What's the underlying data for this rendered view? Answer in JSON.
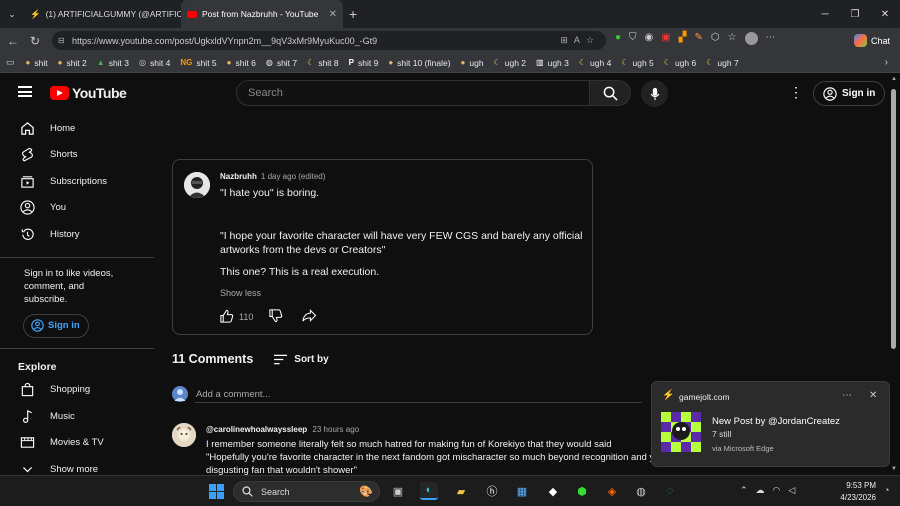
{
  "browser": {
    "tabs": [
      {
        "label": "(1) ARTIFICIALGUMMY (@ARTIFIC",
        "active": false
      },
      {
        "label": "Post from Nazbruhh - YouTube",
        "active": true
      }
    ],
    "url": "https://www.youtube.com/post/UgkxldVYnpn2m__9qV3xMr9MyuKuc00_-Gt9",
    "chat_label": "Chat",
    "bookmarks": [
      "shit",
      "shit 2",
      "shit 3",
      "shit 4",
      "shit 5",
      "shit 6",
      "shit 7",
      "shit 8",
      "shit 9",
      "shit 10 (finale)",
      "ugh",
      "ugh 2",
      "ugh 3",
      "ugh 4",
      "ugh 5",
      "ugh 6",
      "ugh 7"
    ]
  },
  "header": {
    "logo": "YouTube",
    "search_placeholder": "Search",
    "signin": "Sign in"
  },
  "sidebar": {
    "items": [
      "Home",
      "Shorts",
      "Subscriptions",
      "You",
      "History"
    ],
    "signin_note": "Sign in to like videos, comment, and subscribe.",
    "signin_button": "Sign in",
    "explore_title": "Explore",
    "explore_items": [
      "Shopping",
      "Music",
      "Movies & TV"
    ],
    "show_more": "Show more"
  },
  "post": {
    "author": "Nazbruhh",
    "time": "1 day ago (edited)",
    "lines": [
      "\"I hate you\" is boring.",
      "\"I hope your favorite character will have very FEW CGS and barely any official artworks from the devs or Creators\"",
      "This one? This is a real execution."
    ],
    "show_less": "Show less",
    "likes": "110"
  },
  "comments": {
    "count": "11 Comments",
    "sort": "Sort by",
    "add_placeholder": "Add a comment...",
    "items": [
      {
        "author": "@carolinewhoalwayssleep",
        "time": "23 hours ago",
        "lines": [
          "I remember someone literally felt so much hatred for making fun of Korekiyo that they would said",
          "\"Hopefully you're favorite character in the next fandom got mischaracter so much beyond recognition and you",
          "disgusting fan that wouldn't shower\""
        ]
      }
    ]
  },
  "notification": {
    "source": "gamejolt.com",
    "title": "New Post by @JordanCreatez",
    "body": "7 still",
    "via": "via Microsoft Edge"
  },
  "taskbar": {
    "search": "Search",
    "time": "9:53 PM",
    "date": "4/23/2026"
  }
}
